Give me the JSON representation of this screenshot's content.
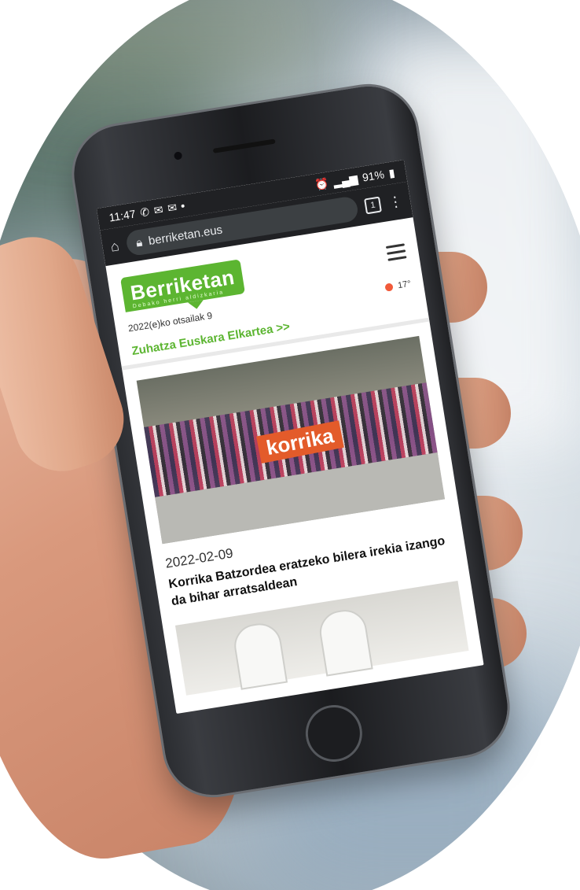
{
  "status_bar": {
    "time": "11:47",
    "notification_icons": [
      "whatsapp-icon",
      "gmail-icon",
      "gmail-icon"
    ],
    "battery": "91%",
    "status_icons": [
      "alarm-icon",
      "data-icon",
      "signal-icon",
      "battery-icon"
    ]
  },
  "browser": {
    "url": "berriketan.eus",
    "tab_count": "1"
  },
  "site": {
    "logo_text": "Berriketan",
    "logo_subtitle": "Debako herri aldizkaria",
    "date": "2022(e)ko otsailak 9",
    "weather": "17°",
    "association_link": "Zuhatza Euskara Elkartea >>"
  },
  "article": {
    "date": "2022-02-09",
    "title": "Korrika Batzordea eratzeko bilera irekia izango da bihar arratsaldean",
    "image_banner": "korrika"
  },
  "colors": {
    "brand_green": "#5cb531",
    "weather_dot": "#f15a3a",
    "browser_chrome": "#202124"
  }
}
